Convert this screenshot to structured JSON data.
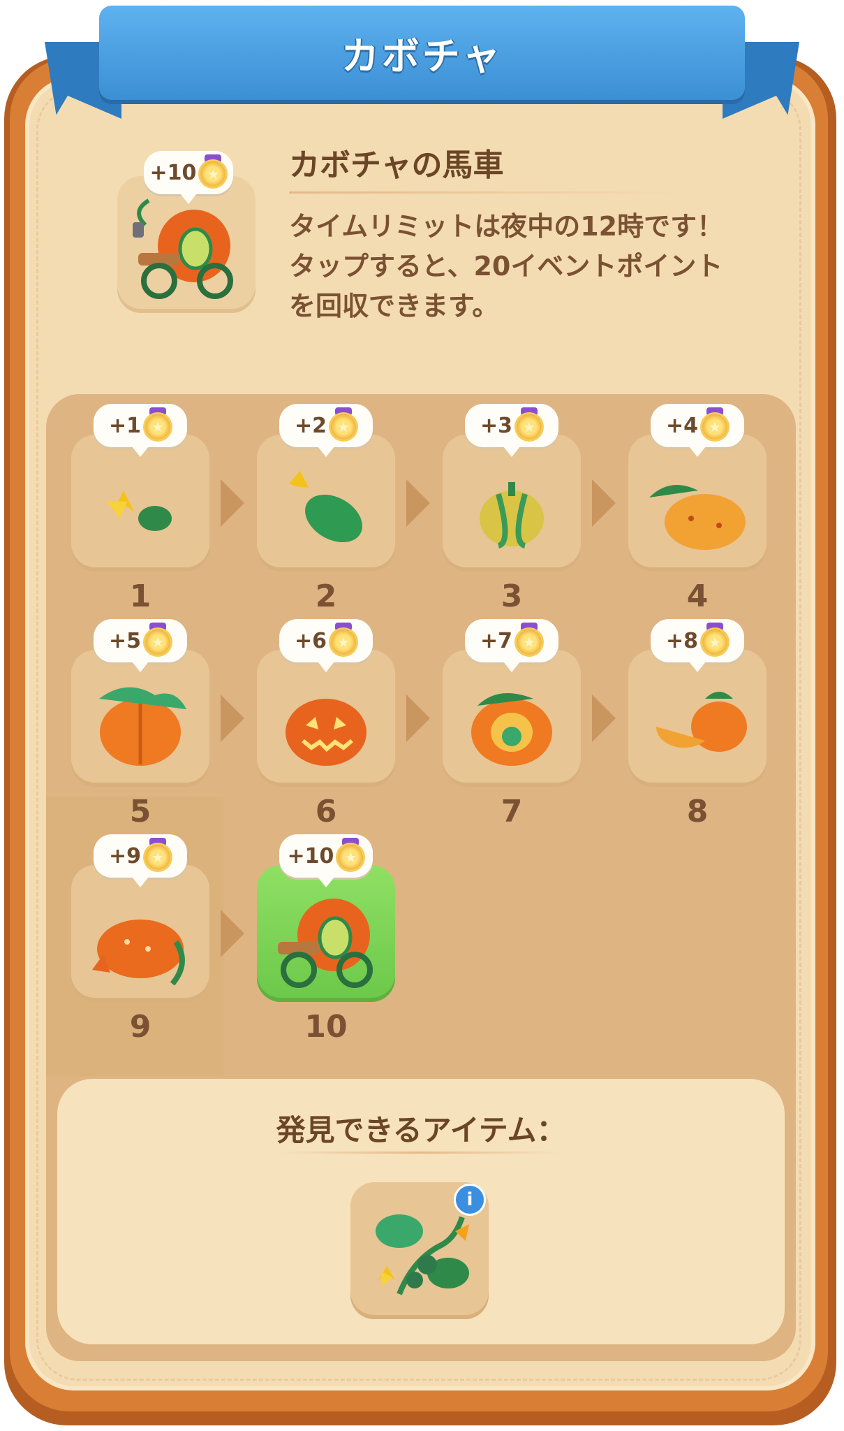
{
  "header": {
    "title": "カボチャ"
  },
  "item": {
    "name": "カボチャの馬車",
    "points_badge": "+10",
    "description": "タイムリミットは夜中の12時です！タップすると、20イベントポイントを回収できます。"
  },
  "chain": [
    {
      "level": "1",
      "points": "+1",
      "icon": "pumpkin-flower-icon"
    },
    {
      "level": "2",
      "points": "+2",
      "icon": "green-squash-icon"
    },
    {
      "level": "3",
      "points": "+3",
      "icon": "small-pumpkin-icon"
    },
    {
      "level": "4",
      "points": "+4",
      "icon": "speckled-pumpkin-icon"
    },
    {
      "level": "5",
      "points": "+5",
      "icon": "orange-pumpkin-icon"
    },
    {
      "level": "6",
      "points": "+6",
      "icon": "jack-o-lantern-icon"
    },
    {
      "level": "7",
      "points": "+7",
      "icon": "carved-pumpkin-icon"
    },
    {
      "level": "8",
      "points": "+8",
      "icon": "cut-pumpkin-icon"
    },
    {
      "level": "9",
      "points": "+9",
      "icon": "pumpkin-creature-icon"
    },
    {
      "level": "10",
      "points": "+10",
      "icon": "pumpkin-carriage-icon"
    }
  ],
  "discover": {
    "title": "発見できるアイテム：",
    "item_icon": "pumpkin-vine-icon",
    "info_label": "i"
  },
  "colors": {
    "ribbon": "#4aa2e4",
    "panel": "#d97f35",
    "panel_inner": "#f4dcb2",
    "highlight_tile": "#7cd455"
  }
}
